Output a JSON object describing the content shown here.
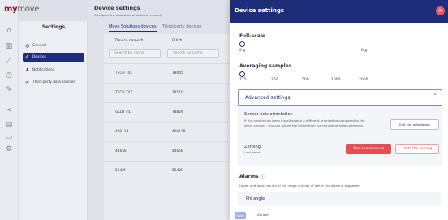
{
  "brand": {
    "logo_accent": "my",
    "logo_rest": "move",
    "accent": "#1f2d78",
    "danger": "#e34e55"
  },
  "iconbar": {
    "icons": [
      "home-icon",
      "chart-icon",
      "trend-icon",
      "clock-icon",
      "tool-icon",
      "share-icon",
      "document-icon",
      "folder-icon",
      "gear-icon"
    ]
  },
  "settings_panel": {
    "title": "Settings",
    "items": [
      {
        "label": "General",
        "icon": "globe-icon"
      },
      {
        "label": "Devices",
        "icon": "wrench-icon"
      },
      {
        "label": "Notifications",
        "icon": "bell-icon"
      },
      {
        "label": "Third-party data sources",
        "icon": "link-icon"
      }
    ]
  },
  "main": {
    "title": "Device settings",
    "subtitle": "Configure the operation of devices remotely",
    "tabs": [
      "Move Solutions devices",
      "Third-party devices"
    ],
    "columns": [
      "Device name ⇅",
      "EUI ⇅"
    ],
    "search_placeholders": [
      "Search by name",
      "Search by name"
    ],
    "rows": [
      [
        "TECH TILT",
        "78045"
      ],
      [
        "TECH TILT",
        "78110"
      ],
      [
        "GLLH TILT",
        "78829"
      ],
      [
        "40h119",
        "40h119"
      ],
      [
        "44656",
        "44656"
      ],
      [
        "5542f",
        "5542f"
      ]
    ]
  },
  "dialog": {
    "title": "Device settings",
    "close_icon": "close-icon",
    "full_scale": {
      "label": "Full-scale",
      "min": "2 g",
      "max": "8 g",
      "value": "2 g"
    },
    "averaging": {
      "label": "Averaging samples",
      "ticks": [
        "125",
        "250",
        "500",
        "1000",
        "2000"
      ],
      "value": "125"
    },
    "advanced": {
      "label": "Advanced settings",
      "orientation_title": "Sensor axis orientation",
      "orientation_desc": "If this device has been installed with a different orientation compared to the other sensors, you can adjust the orientation for consistent measurements.",
      "edit_button": "Edit the orientation",
      "zeroing_title": "Zeroing",
      "zeroing_last": "Last reset: -",
      "zero_button": "Zero the measure",
      "undo_button": "Undo the zeroing"
    },
    "alarms": {
      "title": "Alarms",
      "subtitle": "Upper and lower bound of the range outside of which the alarm is triggered",
      "item": "Phi angle"
    },
    "save": "Save",
    "cancel": "Cancel"
  }
}
